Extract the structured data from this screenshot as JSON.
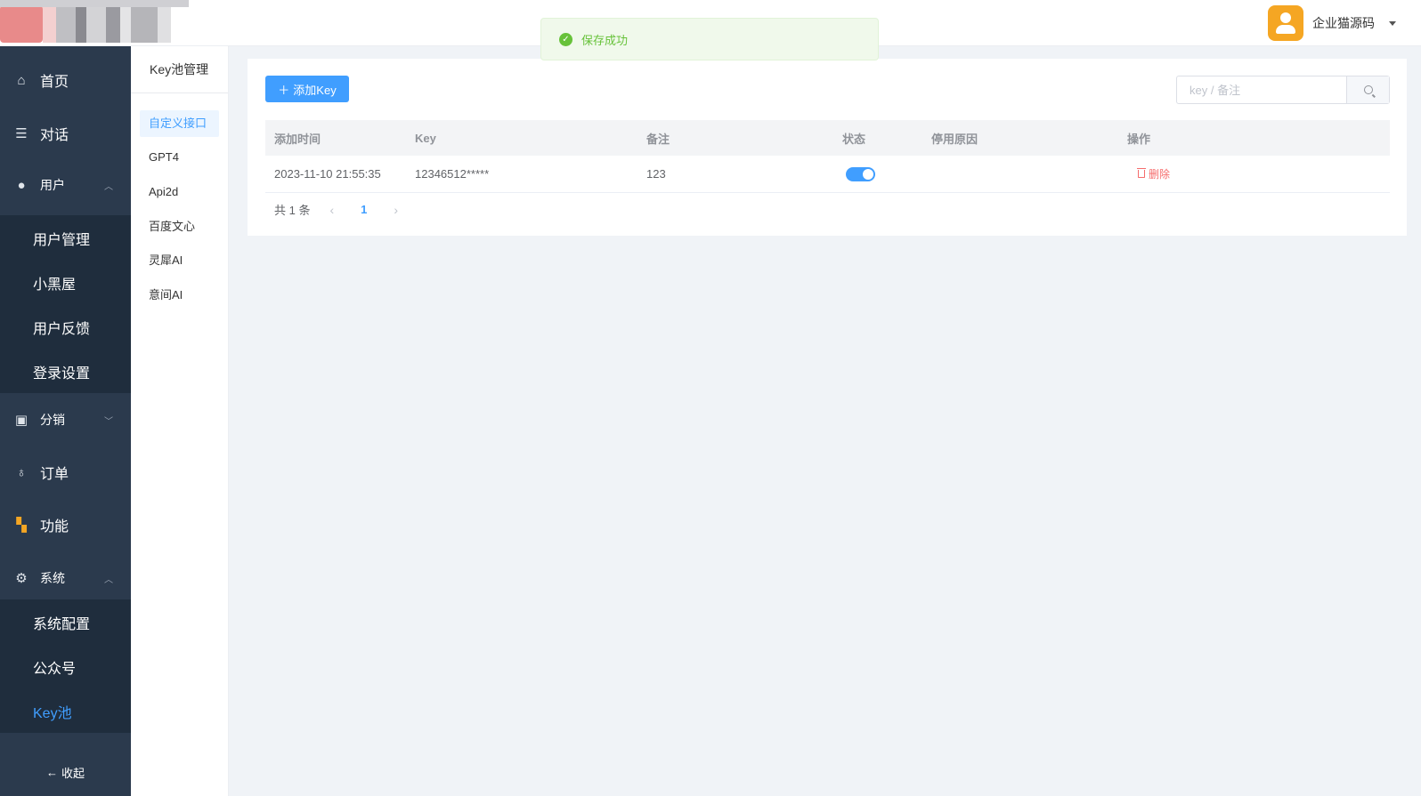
{
  "header": {
    "user_name": "企业猫源码"
  },
  "toast": {
    "message": "保存成功"
  },
  "sidebar": {
    "home": "首页",
    "chat": "对话",
    "user": "用户",
    "user_sub": [
      "用户管理",
      "小黑屋",
      "用户反馈",
      "登录设置"
    ],
    "distribution": "分销",
    "order": "订单",
    "feature": "功能",
    "system": "系统",
    "system_sub": [
      "系统配置",
      "公众号",
      "Key池"
    ],
    "collapse": "收起"
  },
  "sidebar2": {
    "title": "Key池管理",
    "items": [
      "自定义接口",
      "GPT4",
      "Api2d",
      "百度文心",
      "灵犀AI",
      "意间AI"
    ]
  },
  "toolbar": {
    "add_label": "添加Key",
    "search_placeholder": "key / 备注"
  },
  "table": {
    "headers": [
      "添加时间",
      "Key",
      "备注",
      "状态",
      "停用原因",
      "操作"
    ],
    "rows": [
      {
        "time": "2023-11-10 21:55:35",
        "key": "12346512*****",
        "note": "123",
        "status": true,
        "reason": "",
        "action": "删除"
      }
    ]
  },
  "pagination": {
    "total": "共 1 条",
    "current": "1"
  },
  "colors": {
    "primary": "#409eff",
    "success": "#67c23a",
    "danger": "#f56c6c",
    "sidebar_bg": "#2b3a4d",
    "submenu_bg": "#1f2d3d"
  }
}
